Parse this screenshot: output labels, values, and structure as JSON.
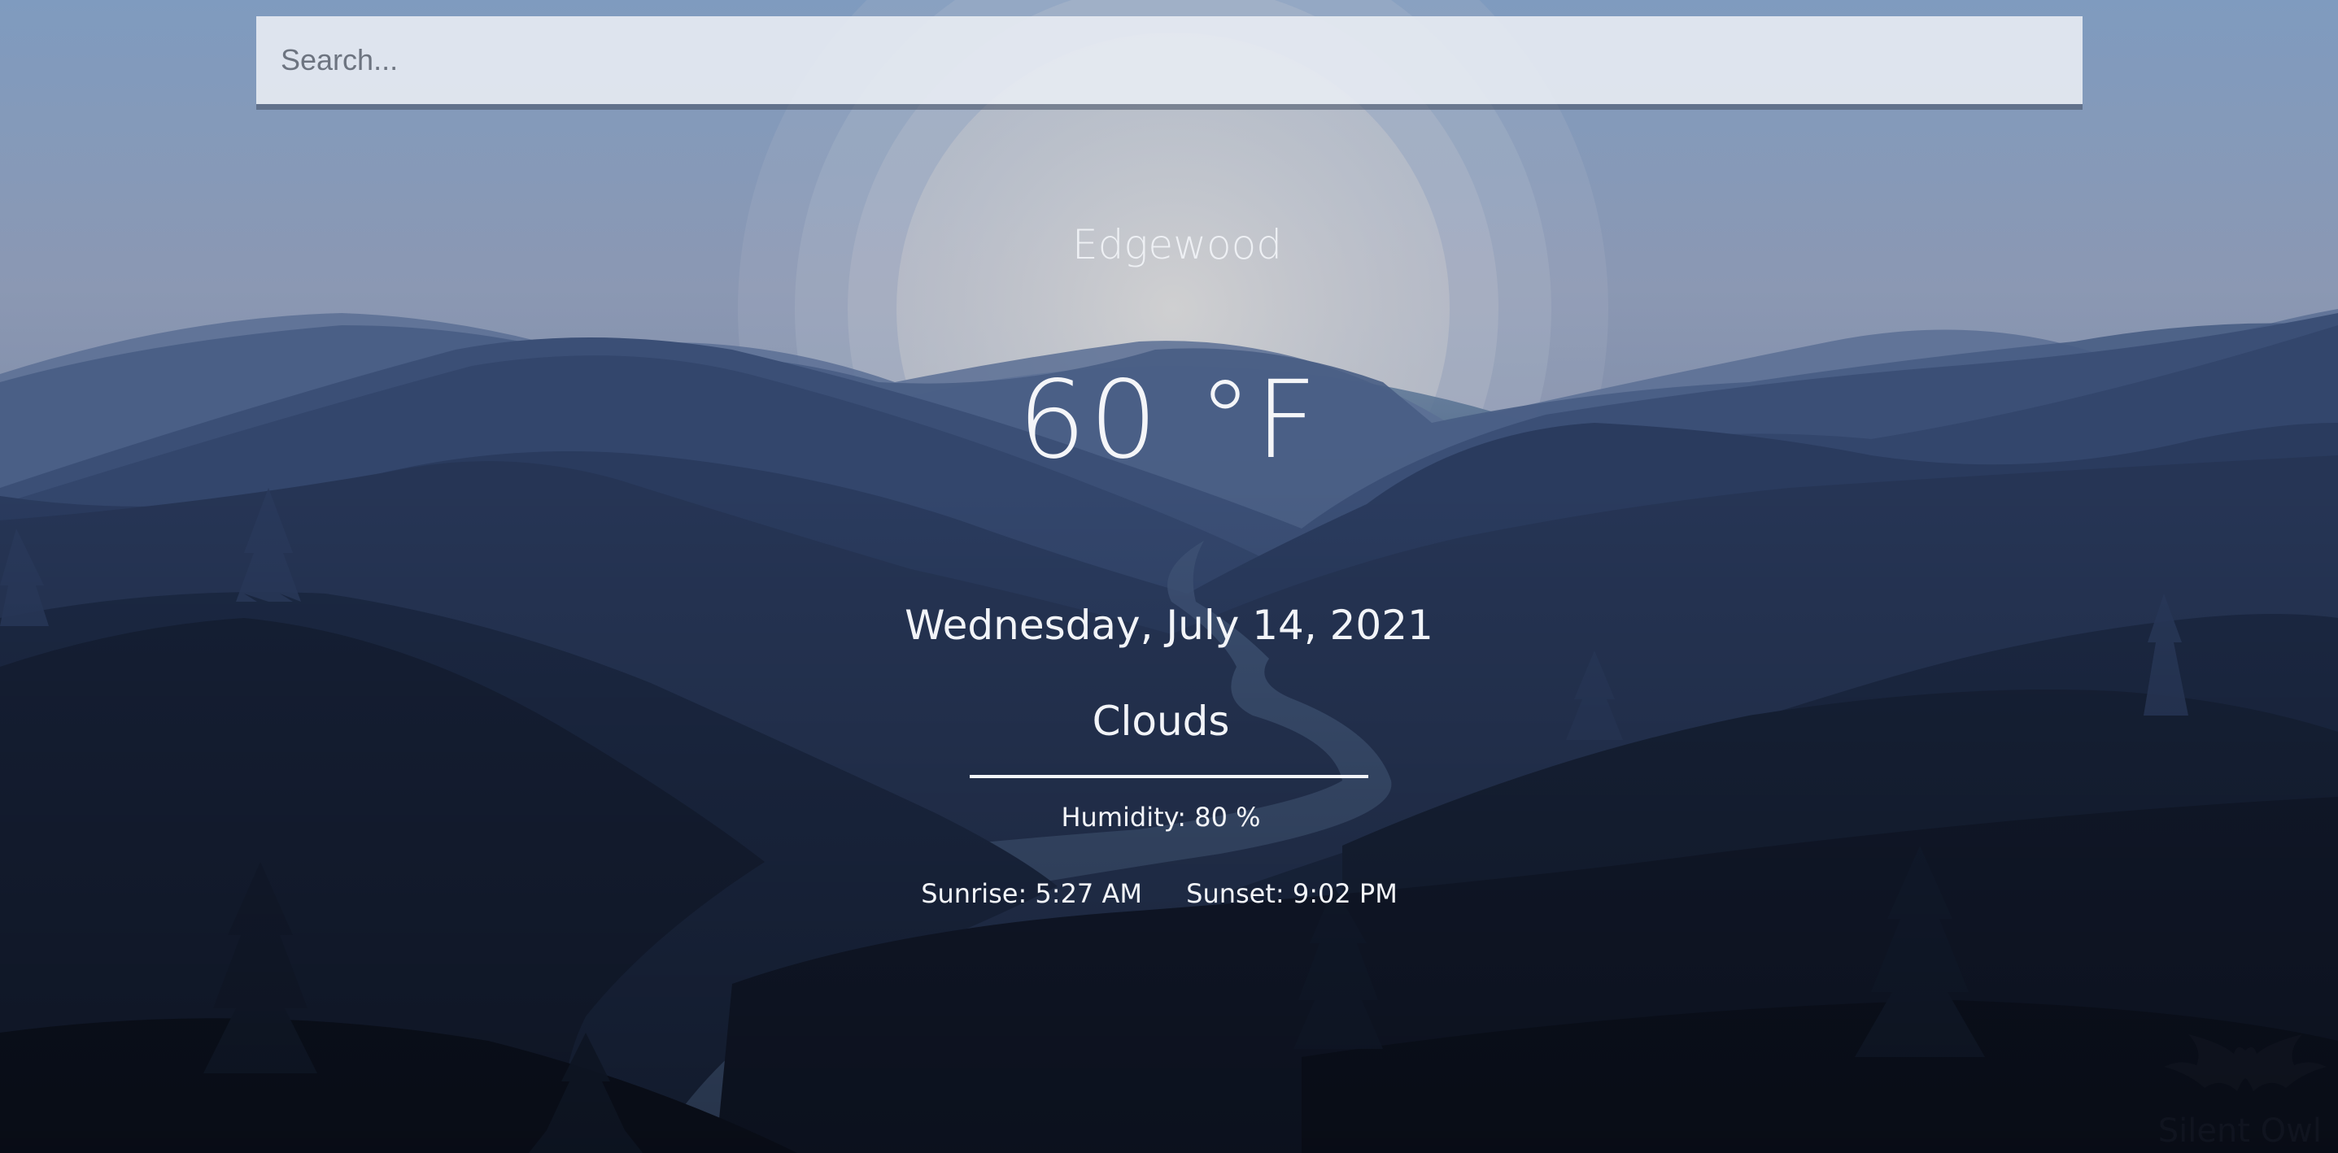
{
  "search": {
    "placeholder": "Search..."
  },
  "weather": {
    "city": "Edgewood",
    "temperature": "60 °F",
    "date": "Wednesday, July 14, 2021",
    "description": "Clouds",
    "humidity": "Humidity: 80 %",
    "sunrise": "Sunrise: 5:27 AM",
    "sunset": "Sunset: 9:02 PM"
  },
  "watermark": {
    "text": "Silent Owl"
  },
  "colors": {
    "sky_top": "#7f9bbf",
    "sky_mid": "#8e9bb5",
    "sun": "#d8d6d2",
    "hills_far": "#4c6288",
    "hills_near": "#0e1526",
    "text": "#f2f4f8"
  }
}
